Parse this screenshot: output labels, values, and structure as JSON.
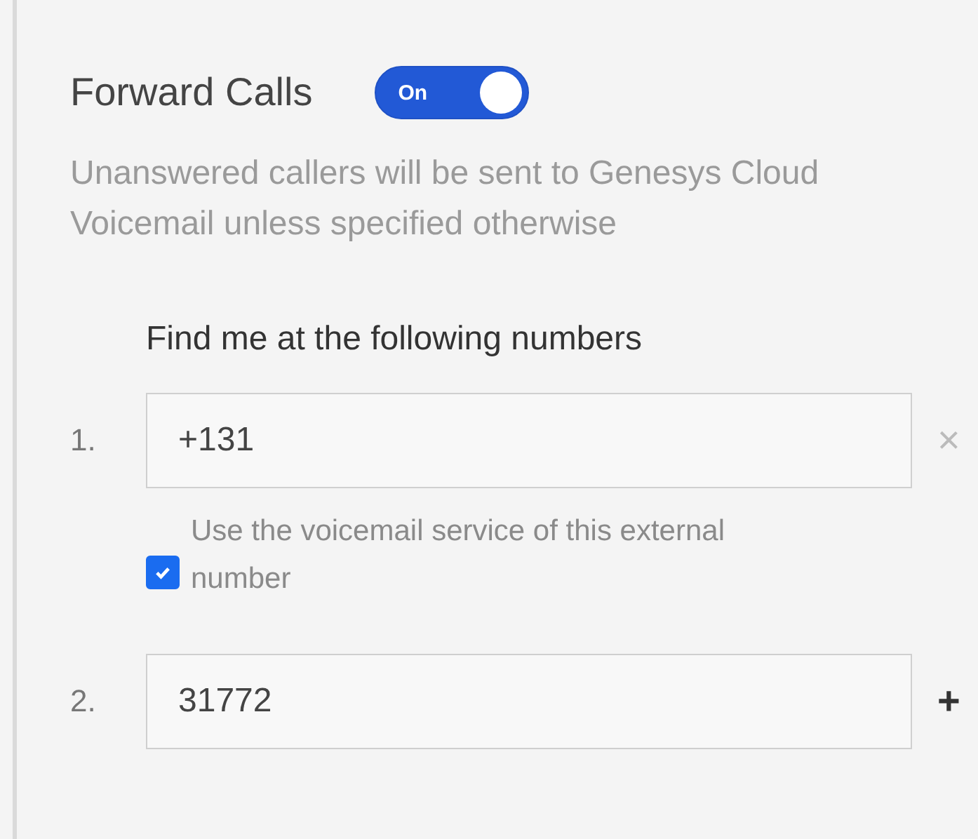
{
  "section": {
    "title": "Forward Calls",
    "toggle": {
      "label": "On",
      "on": true
    },
    "description": "Unanswered callers will be sent to Genesys Cloud Voicemail unless specified otherwise"
  },
  "numbers_heading": "Find me at the following numbers",
  "numbers": [
    {
      "index": "1.",
      "value": "+131",
      "action": "×",
      "kind": "remove",
      "voicemail_option": {
        "label": "Use the voicemail service of this external number",
        "checked": true
      }
    },
    {
      "index": "2.",
      "value": "31772",
      "action": "+",
      "kind": "add"
    }
  ]
}
